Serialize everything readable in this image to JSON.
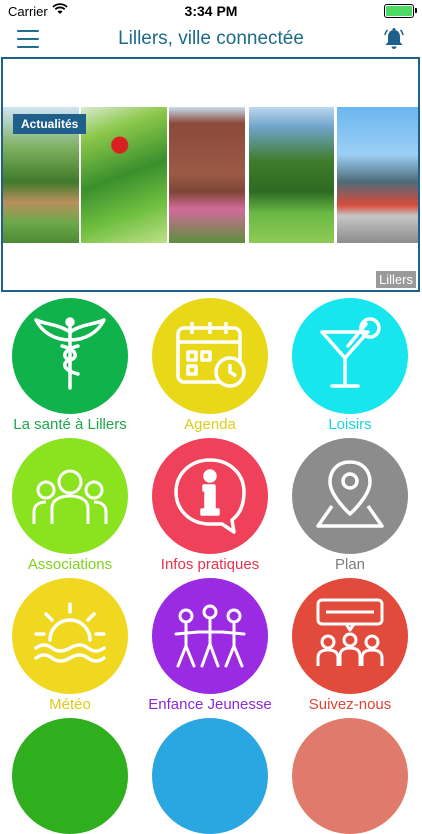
{
  "status_bar": {
    "carrier": "Carrier",
    "time": "3:34 PM"
  },
  "header": {
    "title": "Lillers, ville connectée"
  },
  "carousel": {
    "badge": "Actualités",
    "caption": "Lillers"
  },
  "tiles": [
    {
      "label": "La santé à Lillers",
      "color": "#0fb24b",
      "icon": "caduceus-icon"
    },
    {
      "label": "Agenda",
      "color": "#e9d817",
      "icon": "calendar-clock-icon"
    },
    {
      "label": "Loisirs",
      "color": "#17e6ef",
      "icon": "cocktail-icon"
    },
    {
      "label": "Associations",
      "color": "#8be21f",
      "icon": "group-people-icon"
    },
    {
      "label": "Infos pratiques",
      "color": "#ef4159",
      "icon": "info-bubble-icon"
    },
    {
      "label": "Plan",
      "color": "#8c8c8c",
      "icon": "map-pin-icon"
    },
    {
      "label": "Météo",
      "color": "#efd81f",
      "icon": "sun-sea-icon"
    },
    {
      "label": "Enfance Jeunesse",
      "color": "#9a2be2",
      "icon": "children-icon"
    },
    {
      "label": "Suivez-nous",
      "color": "#e24b3b",
      "icon": "community-chat-icon"
    }
  ],
  "label_colors": [
    "#1ea84a",
    "#dccd1b",
    "#17d5e2",
    "#7fd11d",
    "#e5334e",
    "#7e7e7e",
    "#e0c918",
    "#8c2ad2",
    "#dd4535"
  ],
  "bottom_row_colors": [
    "#2fae1e",
    "#2aa7e0",
    "#e07a6a"
  ]
}
